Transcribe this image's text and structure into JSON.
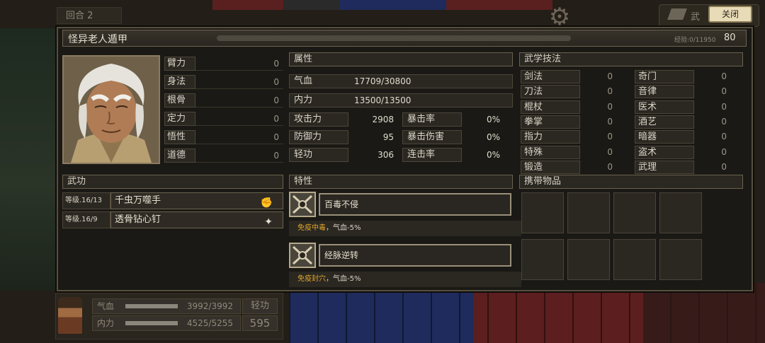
{
  "background": {
    "round_label": "回合 2",
    "top_button_label": "武",
    "hud": {
      "hp_label": "气血",
      "hp_value": "3992/3992",
      "mp_label": "内力",
      "mp_value": "4525/5255",
      "qinggong_label": "轻功",
      "qinggong_value": "595"
    }
  },
  "header": {
    "name": "怪异老人遁甲",
    "exp": "经验:0/11950",
    "level": "80",
    "close_label": "关闭"
  },
  "base_stats": [
    {
      "label": "臂力",
      "value": "0"
    },
    {
      "label": "身法",
      "value": "0"
    },
    {
      "label": "根骨",
      "value": "0"
    },
    {
      "label": "定力",
      "value": "0"
    },
    {
      "label": "悟性",
      "value": "0"
    },
    {
      "label": "道德",
      "value": "0"
    }
  ],
  "attributes": {
    "title": "属性",
    "hp": {
      "label": "气血",
      "value": "17709/30800"
    },
    "mp": {
      "label": "内力",
      "value": "13500/13500"
    },
    "grid": [
      {
        "label": "攻击力",
        "value": "2908",
        "label2": "暴击率",
        "value2": "0%"
      },
      {
        "label": "防御力",
        "value": "95",
        "label2": "暴击伤害",
        "value2": "0%"
      },
      {
        "label": "轻功",
        "value": "306",
        "label2": "连击率",
        "value2": "0%"
      }
    ]
  },
  "martial_techniques": {
    "title": "武学技法",
    "left": [
      {
        "label": "剑法",
        "value": "0"
      },
      {
        "label": "刀法",
        "value": "0"
      },
      {
        "label": "棍杖",
        "value": "0"
      },
      {
        "label": "拳掌",
        "value": "0"
      },
      {
        "label": "指力",
        "value": "0"
      },
      {
        "label": "特殊",
        "value": "0"
      },
      {
        "label": "锻造",
        "value": "0"
      }
    ],
    "right": [
      {
        "label": "奇门",
        "value": "0"
      },
      {
        "label": "音律",
        "value": "0"
      },
      {
        "label": "医术",
        "value": "0"
      },
      {
        "label": "酒艺",
        "value": "0"
      },
      {
        "label": "暗器",
        "value": "0"
      },
      {
        "label": "盗术",
        "value": "0"
      },
      {
        "label": "武理",
        "value": "0"
      }
    ]
  },
  "kungfu": {
    "title": "武功",
    "items": [
      {
        "level": "等级.16/13",
        "name": "千虫万噬手",
        "icon": "fist-icon"
      },
      {
        "level": "等级.16/9",
        "name": "透骨钻心钉",
        "icon": "shuriken-icon"
      }
    ]
  },
  "traits": {
    "title": "特性",
    "items": [
      {
        "name": "百毒不侵",
        "desc_highlight": "免疫中毒",
        "desc_rest": "，气血-5%"
      },
      {
        "name": "经脉逆转",
        "desc_highlight": "免疫封穴",
        "desc_rest": "，气血-5%"
      }
    ]
  },
  "inventory": {
    "title": "携带物品"
  },
  "colors": {
    "panel_bg": "#1b1915",
    "border": "#57503f",
    "highlight": "#e0a52a",
    "button": "#e8dcb8"
  }
}
